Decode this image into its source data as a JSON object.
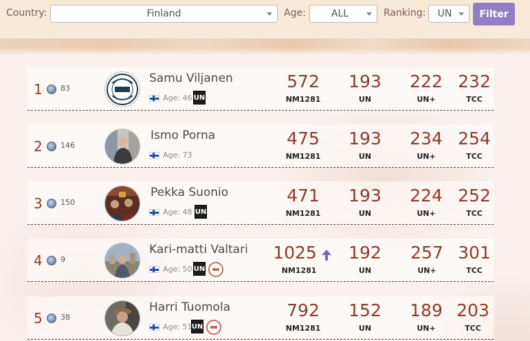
{
  "filters": {
    "country_label": "Country:",
    "country_value": "Finland",
    "age_label": "Age:",
    "age_value": "ALL",
    "ranking_label": "Ranking:",
    "ranking_value": "UN",
    "filter_button": "Filter"
  },
  "rows": [
    {
      "rank": "1",
      "nm_rank": "83",
      "name": "Samu Viljanen",
      "age": "Age: 46",
      "badges": [
        "un"
      ],
      "avatar": "nomad-logo",
      "scores": {
        "nm": "572",
        "nm_label": "NM1281",
        "un": "193",
        "un_label": "UN",
        "unplus": "222",
        "unplus_label": "UN+",
        "tcc": "232",
        "tcc_label": "TCC"
      }
    },
    {
      "rank": "2",
      "nm_rank": "146",
      "name": "Ismo Porna",
      "age": "Age: 73",
      "badges": [],
      "avatar": "photo",
      "scores": {
        "nm": "475",
        "nm_label": "NM1281",
        "un": "193",
        "un_label": "UN",
        "unplus": "234",
        "unplus_label": "UN+",
        "tcc": "254",
        "tcc_label": "TCC"
      }
    },
    {
      "rank": "3",
      "nm_rank": "150",
      "name": "Pekka Suonio",
      "age": "Age: 48",
      "badges": [
        "un"
      ],
      "avatar": "photo",
      "scores": {
        "nm": "471",
        "nm_label": "NM1281",
        "un": "193",
        "un_label": "UN",
        "unplus": "224",
        "unplus_label": "UN+",
        "tcc": "252",
        "tcc_label": "TCC"
      }
    },
    {
      "rank": "4",
      "nm_rank": "9",
      "name": "Kari-matti Valtari",
      "age": "Age: 50",
      "badges": [
        "un",
        "nomad"
      ],
      "avatar": "photo",
      "trend": "up",
      "scores": {
        "nm": "1025",
        "nm_label": "NM1281",
        "un": "192",
        "un_label": "UN",
        "unplus": "257",
        "unplus_label": "UN+",
        "tcc": "301",
        "tcc_label": "TCC"
      }
    },
    {
      "rank": "5",
      "nm_rank": "38",
      "name": "Harri Tuomola",
      "age": "Age: 51",
      "badges": [
        "un",
        "nomad"
      ],
      "avatar": "photo",
      "scores": {
        "nm": "792",
        "nm_label": "NM1281",
        "un": "152",
        "un_label": "UN",
        "unplus": "189",
        "unplus_label": "UN+",
        "tcc": "203",
        "tcc_label": "TCC"
      }
    }
  ],
  "badge_text": {
    "un": "UN"
  },
  "colors": {
    "score": "#8d3b28",
    "button": "#9080c2",
    "trend_up": "#7a68b8"
  }
}
